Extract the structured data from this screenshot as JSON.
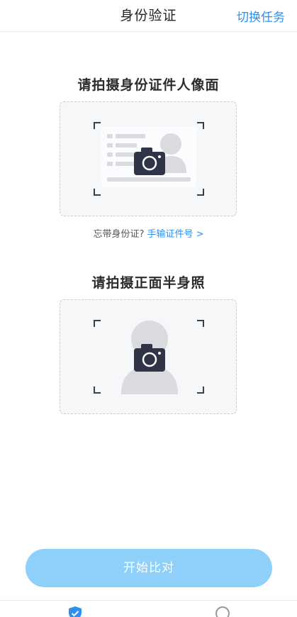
{
  "header": {
    "title": "身份验证",
    "switch_label": "切换任务"
  },
  "id_card_section": {
    "title": "请拍摄身份证件人像面",
    "capture_icon": "id-card-camera-icon"
  },
  "hint": {
    "text": "忘带身份证?",
    "link_label": "手输证件号 >"
  },
  "portrait_section": {
    "title": "请拍摄正面半身照",
    "capture_icon": "portrait-camera-icon"
  },
  "start_button": {
    "label": "开始比对"
  },
  "tabbar": {
    "items": [
      {
        "icon": "shield-check-icon"
      },
      {
        "icon": "circle-icon"
      }
    ]
  },
  "colors": {
    "accent": "#2d8ff0",
    "button_bg": "#8fd0fb",
    "camera": "#2f3447",
    "placeholder_gray": "#d9dbdf"
  }
}
